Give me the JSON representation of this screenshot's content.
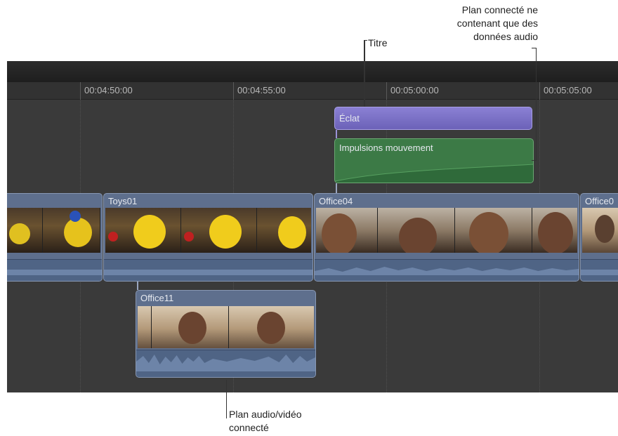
{
  "callouts": {
    "title": "Titre",
    "audio_only_line1": "Plan connecté ne",
    "audio_only_line2": "contenant que des",
    "audio_only_line3": "données audio",
    "av_line1": "Plan audio/vidéo",
    "av_line2": "connecté"
  },
  "ruler": {
    "ticks": [
      "00:04:50:00",
      "00:04:55:00",
      "00:05:00:00",
      "00:05:05:00"
    ]
  },
  "clips": {
    "title_clip": "Éclat",
    "audio_clip": "Impulsions mouvement",
    "toys": "Toys01",
    "office04": "Office04",
    "office_cut": "Office0",
    "office11": "Office11"
  },
  "colors": {
    "timeline_bg": "#3a3a3a",
    "title_clip": "#7a6fc4",
    "audio_clip": "#3f7f4a",
    "av_clip": "#5e6f8d"
  }
}
